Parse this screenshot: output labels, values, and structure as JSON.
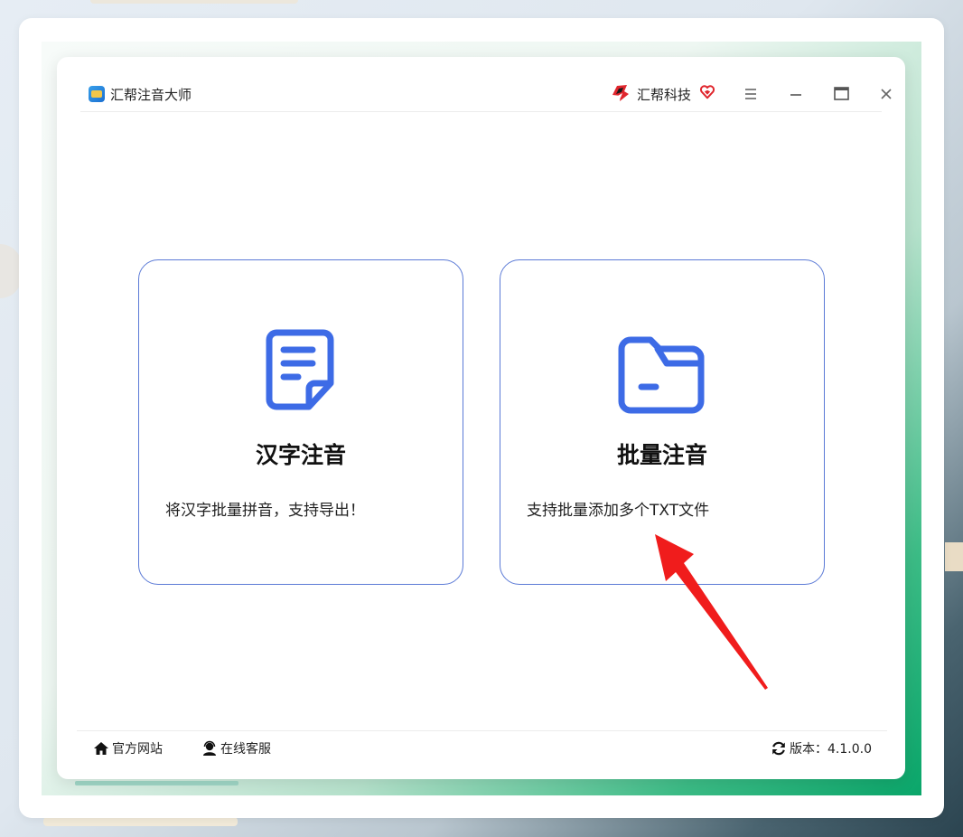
{
  "app": {
    "title": "汇帮注音大师"
  },
  "brand": {
    "name": "汇帮科技"
  },
  "cards": [
    {
      "title": "汉字注音",
      "description": "将汉字批量拼音，支持导出！"
    },
    {
      "title": "批量注音",
      "description": "支持批量添加多个TXT文件"
    }
  ],
  "footer": {
    "website_label": "官方网站",
    "service_label": "在线客服",
    "version_label": "版本：4.1.0.0"
  },
  "colors": {
    "accent_blue": "#3d6be6",
    "card_border": "#5b7ad6",
    "arrow_red": "#f01c1c",
    "brand_red": "#e0262d"
  },
  "icons": {
    "app_logo": "app-logo-icon",
    "brand_logo": "brand-logo-icon",
    "heart": "heart-icon",
    "menu": "menu-icon",
    "minimize": "minimize-icon",
    "maximize": "maximize-icon",
    "close": "close-icon",
    "document": "document-icon",
    "folder": "folder-icon",
    "home": "home-icon",
    "support": "support-icon",
    "refresh": "refresh-icon"
  }
}
